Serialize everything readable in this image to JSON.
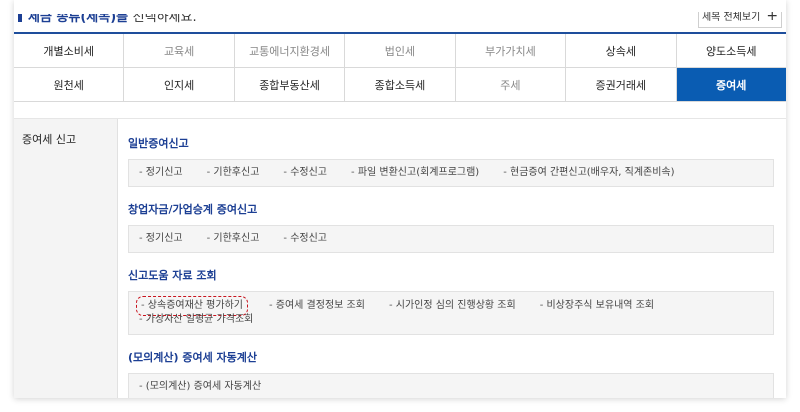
{
  "header": {
    "title_main": "세금 종류(세목)를",
    "title_rest": "선택하세요.",
    "all_button_label": "세목 전체보기",
    "all_button_icon": "plus-icon"
  },
  "tabs": {
    "row1": [
      "개별소비세",
      "교육세",
      "교통에너지환경세",
      "법인세",
      "부가가치세",
      "상속세",
      "양도소득세"
    ],
    "row2": [
      "원천세",
      "인지세",
      "종합부동산세",
      "종합소득세",
      "주세",
      "증권거래세",
      "증여세"
    ],
    "active": "증여세",
    "active_color": "#0a5cb2"
  },
  "sidebar": {
    "label": "증여세 신고"
  },
  "sections": [
    {
      "title": "일반증여신고",
      "items": [
        "정기신고",
        "기한후신고",
        "수정신고",
        "파일 변환신고(회계프로그램)",
        "현금증여 간편신고(배우자, 직계존비속)"
      ]
    },
    {
      "title": "창업자금/가업승계 증여신고",
      "items": [
        "정기신고",
        "기한후신고",
        "수정신고"
      ]
    },
    {
      "title": "신고도움 자료 조회",
      "items": [
        "상속증여재산 평가하기",
        "증여세 결정정보 조회",
        "시가인정 심의 진행상황 조회",
        "비상장주식 보유내역 조회",
        "가상자산 일평균 가격조회"
      ],
      "highlighted": "상속증여재산 평가하기"
    },
    {
      "title": "(모의계산) 증여세 자동계산",
      "items": [
        "(모의계산) 증여세 자동계산"
      ]
    }
  ]
}
